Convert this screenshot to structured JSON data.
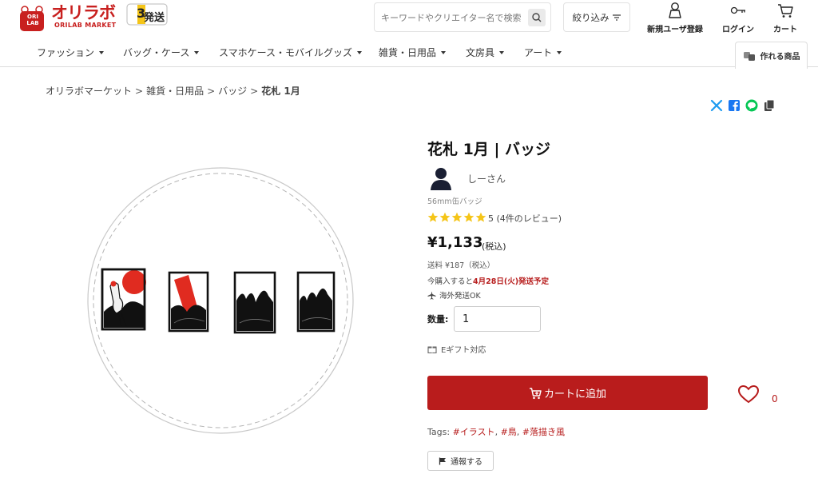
{
  "header": {
    "logo_text": "オリラボ",
    "logo_sub": "ORILAB MARKET",
    "logo_badge_text": "ORI LAB",
    "ship_badge_text": "発送",
    "ship_badge_number": "3",
    "search": {
      "placeholder": "キーワードやクリエイター名で検索"
    },
    "filter_label": "絞り込み",
    "register_label": "新規ユーザ登録",
    "login_label": "ログイン",
    "cart_label": "カート"
  },
  "nav": {
    "items": [
      {
        "label": "ファッション"
      },
      {
        "label": "バッグ・ケース"
      },
      {
        "label": "スマホケース・モバイルグッズ"
      },
      {
        "label": "雑貨・日用品"
      },
      {
        "label": "文房具"
      },
      {
        "label": "アート"
      }
    ],
    "makeable_label": "作れる商品"
  },
  "breadcrumb": {
    "items": [
      "オリラボマーケット",
      "雑貨・日用品",
      "バッジ"
    ],
    "current": "花札 1月",
    "separator": ">"
  },
  "product": {
    "title": "花札 1月 | バッジ",
    "creator": "しーさん",
    "spec": "56mm缶バッジ",
    "rating_value": 5,
    "rating_text": "5 (4件のレビュー)",
    "price": "¥1,133",
    "price_tax": "(税込)",
    "shipping": "送料 ¥187（税込）",
    "delivery_prefix": "今購入すると",
    "delivery_date": "4月28日(火)発送予定",
    "overseas": "海外発送OK",
    "quantity_label": "数量:",
    "quantity_value": "1",
    "egift": "Eギフト対応",
    "add_to_cart": "カートに追加",
    "favorite_count": "0",
    "tags_label": "Tags:",
    "tags": [
      "#イラスト",
      "#鳥",
      "#落描き風"
    ],
    "report": "通報する"
  },
  "colors": {
    "brand_red": "#c8201f",
    "cart_button": "#b91c1c",
    "star": "#f5c518"
  }
}
